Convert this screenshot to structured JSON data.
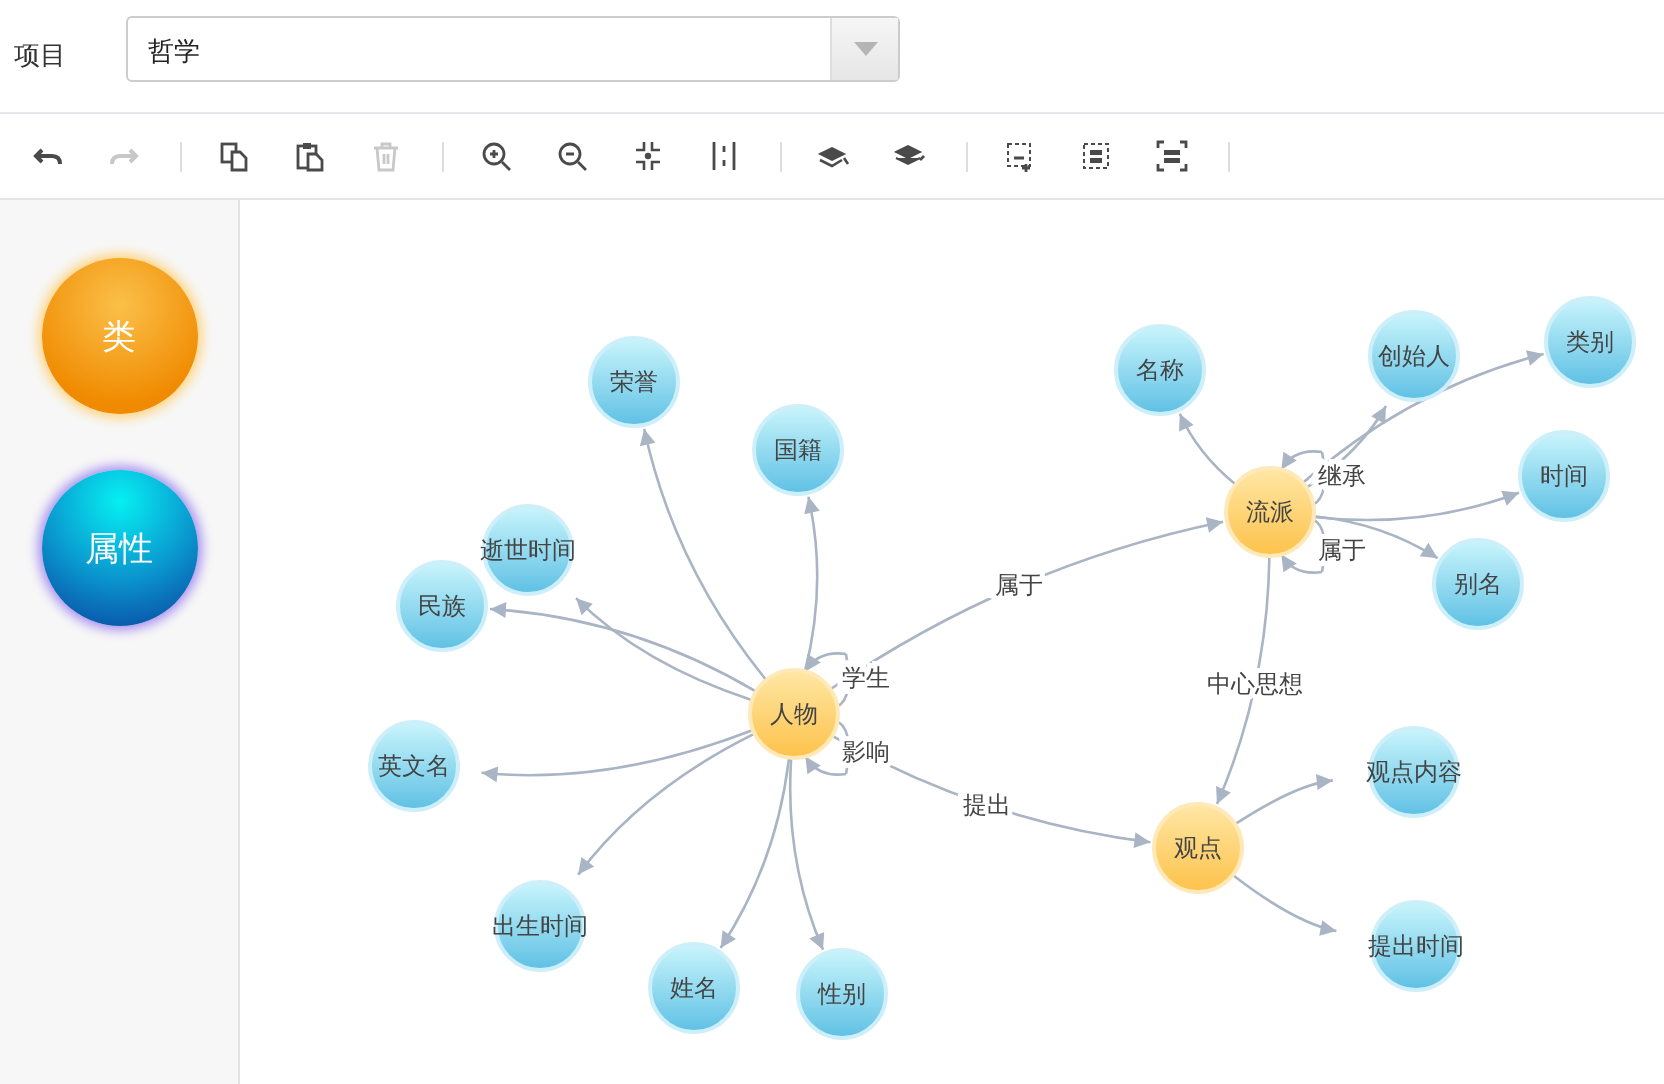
{
  "header": {
    "label": "项目",
    "select": {
      "value": "哲学"
    }
  },
  "toolbar": [
    [
      {
        "kind": "undo",
        "disabled": false
      },
      {
        "kind": "redo",
        "disabled": true
      }
    ],
    [
      {
        "kind": "copy",
        "disabled": false
      },
      {
        "kind": "paste",
        "disabled": false
      },
      {
        "kind": "delete",
        "disabled": true
      }
    ],
    [
      {
        "kind": "zoom-in",
        "disabled": false
      },
      {
        "kind": "zoom-out",
        "disabled": false
      },
      {
        "kind": "fit",
        "disabled": false
      },
      {
        "kind": "split",
        "disabled": false
      }
    ],
    [
      {
        "kind": "layers-front",
        "disabled": false
      },
      {
        "kind": "layers-back",
        "disabled": false
      }
    ],
    [
      {
        "kind": "select-add",
        "disabled": false
      },
      {
        "kind": "select-group",
        "disabled": false
      },
      {
        "kind": "select-all",
        "disabled": false
      }
    ]
  ],
  "palette": [
    {
      "label": "类",
      "kind": "class"
    },
    {
      "label": "属性",
      "kind": "attribute"
    }
  ],
  "graph": {
    "classes": [
      {
        "label": "人物",
        "attributes": [
          "荣誉",
          "国籍",
          "逝世时间",
          "民族",
          "英文名",
          "出生时间",
          "姓名",
          "性别"
        ]
      },
      {
        "label": "流派",
        "attributes": [
          "名称",
          "创始人",
          "类别",
          "时间",
          "别名"
        ]
      },
      {
        "label": "观点",
        "attributes": [
          "观点内容",
          "提出时间"
        ]
      }
    ],
    "relations": [
      {
        "label": "学生"
      },
      {
        "label": "影响"
      },
      {
        "label": "属于"
      },
      {
        "label": "提出"
      },
      {
        "label": "继承"
      },
      {
        "label": "属于"
      },
      {
        "label": "中心思想"
      }
    ]
  }
}
